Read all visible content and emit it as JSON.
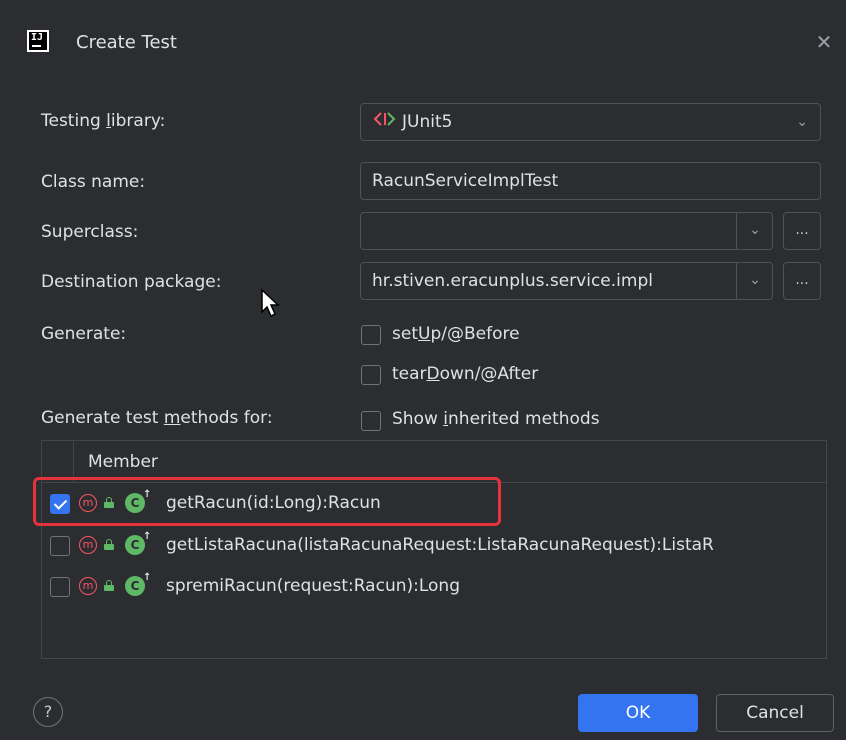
{
  "dialog": {
    "title": "Create Test",
    "app_logo_text": "IJ"
  },
  "form": {
    "testing_library_label": "Testing library:",
    "testing_library_value": "JUnit5",
    "class_name_label": "Class name:",
    "class_name_value": "RacunServiceImplTest",
    "superclass_label": "Superclass:",
    "superclass_value": "",
    "destination_label": "Destination package:",
    "destination_value": "hr.stiven.eracunplus.service.impl",
    "browse_label": "...",
    "generate_label": "Generate:",
    "setup_label": "setUp/@Before",
    "setup_checked": false,
    "teardown_label": "tearDown/@After",
    "teardown_checked": false,
    "methods_for_label": "Generate test methods for:",
    "show_inherited_label": "Show inherited methods",
    "show_inherited_checked": false
  },
  "members": {
    "column_header": "Member",
    "rows": [
      {
        "text": "getRacun(id:Long):Racun",
        "checked": true
      },
      {
        "text": "getListaRacuna(listaRacunaRequest:ListaRacunaRequest):ListaR",
        "checked": false
      },
      {
        "text": "spremiRacun(request:Racun):Long",
        "checked": false
      }
    ]
  },
  "buttons": {
    "help": "?",
    "ok": "OK",
    "cancel": "Cancel"
  },
  "colors": {
    "background": "#2b2d30",
    "accent": "#3574f0",
    "highlight": "#e5333b",
    "method_icon": "#f75464",
    "public_icon": "#5fb865"
  }
}
